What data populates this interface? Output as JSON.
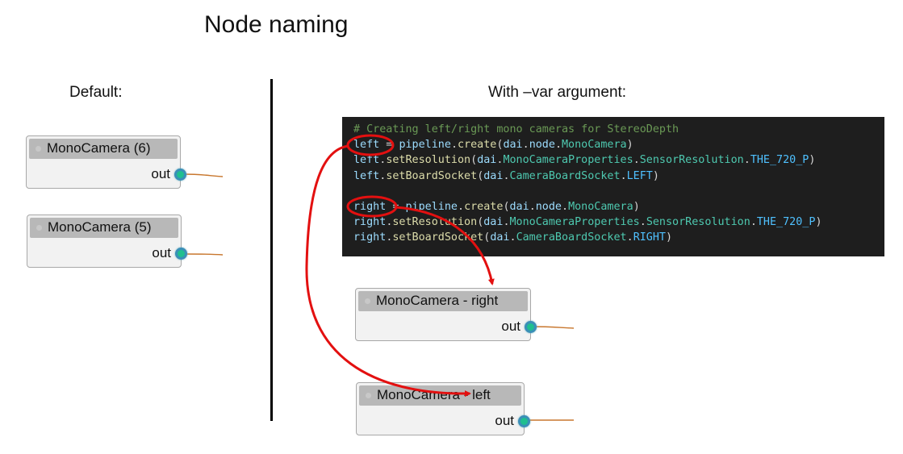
{
  "title": "Node naming",
  "left_panel": {
    "heading": "Default:",
    "nodes": [
      {
        "name": "MonoCamera (6)",
        "port": "out"
      },
      {
        "name": "MonoCamera (5)",
        "port": "out"
      }
    ]
  },
  "right_panel": {
    "heading": "With –var argument:",
    "code": {
      "comment": "# Creating left/right mono cameras for StereoDepth",
      "lines": [
        [
          "left",
          " = ",
          "pipeline",
          ".",
          "create",
          "(",
          "dai",
          ".",
          "node",
          ".",
          "MonoCamera",
          ")"
        ],
        [
          "left",
          ".",
          "setResolution",
          "(",
          "dai",
          ".",
          "MonoCameraProperties",
          ".",
          "SensorResolution",
          ".",
          "THE_720_P",
          ")"
        ],
        [
          "left",
          ".",
          "setBoardSocket",
          "(",
          "dai",
          ".",
          "CameraBoardSocket",
          ".",
          "LEFT",
          ")"
        ],
        [
          "right",
          " = ",
          "pipeline",
          ".",
          "create",
          "(",
          "dai",
          ".",
          "node",
          ".",
          "MonoCamera",
          ")"
        ],
        [
          "right",
          ".",
          "setResolution",
          "(",
          "dai",
          ".",
          "MonoCameraProperties",
          ".",
          "SensorResolution",
          ".",
          "THE_720_P",
          ")"
        ],
        [
          "right",
          ".",
          "setBoardSocket",
          "(",
          "dai",
          ".",
          "CameraBoardSocket",
          ".",
          "RIGHT",
          ")"
        ]
      ]
    },
    "nodes": [
      {
        "name": "MonoCamera - right",
        "port": "out"
      },
      {
        "name": "MonoCamera - left",
        "port": "out"
      }
    ],
    "annotations": {
      "highlight_color": "#e31010",
      "arrows": [
        "left -> MonoCamera - left",
        "right -> MonoCamera - right"
      ]
    }
  },
  "colors": {
    "link_wire": "#c8772e",
    "port_fill": "#1fbf8f",
    "port_ring": "#3a8fb7",
    "code_bg": "#1e1e1e"
  }
}
